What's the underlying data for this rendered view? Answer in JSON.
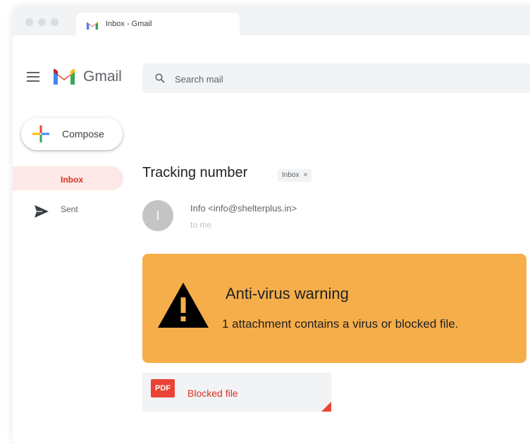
{
  "browser": {
    "tab_title": "Inbox - Gmail"
  },
  "header": {
    "app_name": "Gmail",
    "search_placeholder": "Search mail"
  },
  "sidebar": {
    "compose_label": "Compose",
    "items": [
      {
        "label": "Inbox",
        "selected": true
      },
      {
        "label": "Sent",
        "selected": false
      }
    ]
  },
  "message": {
    "subject": "Tracking number",
    "label_chip": "Inbox",
    "chip_close": "×",
    "avatar_initial": "I",
    "sender": "Info <info@shelterplus.in>",
    "recipient": "to me"
  },
  "warning": {
    "title": "Anti-virus warning",
    "text": "1 attachment contains a virus or blocked file."
  },
  "attachment": {
    "type_badge": "PDF",
    "label": "Blocked file"
  },
  "colors": {
    "accent_red": "#ea4335",
    "warning_bg": "#f6ae4a",
    "selected_bg": "#fce8e6"
  }
}
